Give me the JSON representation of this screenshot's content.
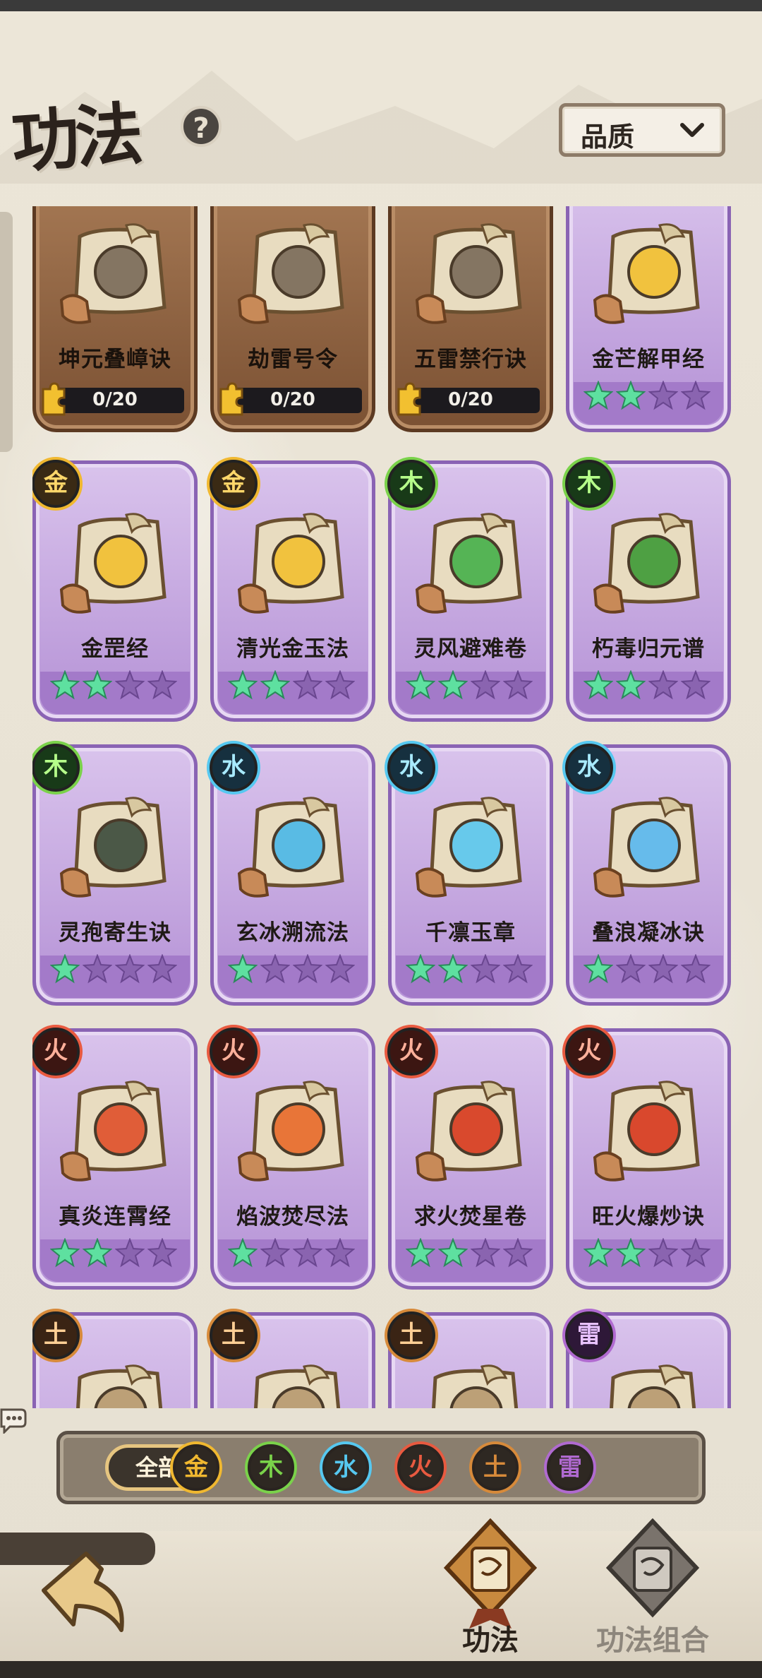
{
  "header": {
    "title": "功法",
    "help_icon": "question-icon",
    "help_label": "?"
  },
  "sort_dropdown": {
    "label": "品质",
    "icon": "chevron-down-icon"
  },
  "cards": [
    {
      "name": "坤元叠嶂诀",
      "element": "earth",
      "style": "brown",
      "progress": "0/20",
      "stars_lit": 0,
      "art": "dragon-frame"
    },
    {
      "name": "劫雷号令",
      "element": "thunder",
      "style": "brown",
      "progress": "0/20",
      "stars_lit": 0,
      "art": "dragon-frame"
    },
    {
      "name": "五雷禁行诀",
      "element": "thunder",
      "style": "brown",
      "progress": "0/20",
      "stars_lit": 0,
      "art": "dragon-frame"
    },
    {
      "name": "金芒解甲经",
      "element": "gold",
      "style": "purple",
      "progress": "",
      "stars_lit": 2,
      "art": "gold-blade"
    },
    {
      "name": "金罡经",
      "element": "gold",
      "badge": "金",
      "style": "purple",
      "stars_lit": 2,
      "art": "gold-up"
    },
    {
      "name": "清光金玉法",
      "element": "gold",
      "badge": "金",
      "style": "purple",
      "stars_lit": 2,
      "art": "gold-ring"
    },
    {
      "name": "灵风避难卷",
      "element": "wood",
      "badge": "木",
      "style": "purple",
      "stars_lit": 2,
      "art": "leaf"
    },
    {
      "name": "朽毒归元谱",
      "element": "wood",
      "badge": "木",
      "style": "purple",
      "stars_lit": 2,
      "art": "poison"
    },
    {
      "name": "灵孢寄生诀",
      "element": "wood",
      "badge": "木",
      "style": "purple",
      "stars_lit": 1,
      "art": "spore"
    },
    {
      "name": "玄冰溯流法",
      "element": "water",
      "badge": "水",
      "style": "purple",
      "stars_lit": 1,
      "art": "wave"
    },
    {
      "name": "千凛玉章",
      "element": "water",
      "badge": "水",
      "style": "purple",
      "stars_lit": 2,
      "art": "ice"
    },
    {
      "name": "叠浪凝冰诀",
      "element": "water",
      "badge": "水",
      "style": "purple",
      "stars_lit": 1,
      "art": "crystal"
    },
    {
      "name": "真炎连霄经",
      "element": "fire",
      "badge": "火",
      "style": "purple",
      "stars_lit": 2,
      "art": "flame"
    },
    {
      "name": "焰波焚尽法",
      "element": "fire",
      "badge": "火",
      "style": "purple",
      "stars_lit": 1,
      "art": "flame-wave"
    },
    {
      "name": "求火焚星卷",
      "element": "fire",
      "badge": "火",
      "style": "purple",
      "stars_lit": 2,
      "art": "fire-fist"
    },
    {
      "name": "旺火爆炒诀",
      "element": "fire",
      "badge": "火",
      "style": "purple",
      "stars_lit": 2,
      "art": "fire-wok"
    },
    {
      "name": "",
      "element": "earth",
      "badge": "土",
      "style": "purple",
      "stars_lit": 0,
      "art": "partial"
    },
    {
      "name": "",
      "element": "earth",
      "badge": "土",
      "style": "purple",
      "stars_lit": 0,
      "art": "partial"
    },
    {
      "name": "",
      "element": "earth",
      "badge": "土",
      "style": "purple",
      "stars_lit": 0,
      "art": "partial"
    },
    {
      "name": "",
      "element": "thunder",
      "badge": "雷",
      "style": "purple",
      "stars_lit": 0,
      "art": "partial"
    }
  ],
  "filters": {
    "all_label": "全部",
    "elements": [
      {
        "label": "金",
        "key": "gold"
      },
      {
        "label": "木",
        "key": "wood"
      },
      {
        "label": "水",
        "key": "water"
      },
      {
        "label": "火",
        "key": "fire"
      },
      {
        "label": "土",
        "key": "earth"
      },
      {
        "label": "雷",
        "key": "thunder"
      }
    ]
  },
  "bottom_nav": {
    "back_icon": "back-arrow-icon",
    "tabs": [
      {
        "label": "功法",
        "icon": "scroll-book-icon",
        "active": true
      },
      {
        "label": "功法组合",
        "icon": "combo-scroll-icon",
        "active": false
      }
    ]
  },
  "colors": {
    "gold": "#f0b830",
    "wood": "#7ad24a",
    "water": "#56c8f0",
    "fire": "#e85a40",
    "earth": "#d78a3a",
    "thunder": "#b06ad0",
    "star_lit": "#5ee0a0",
    "star_dim": "#8a64b0"
  }
}
